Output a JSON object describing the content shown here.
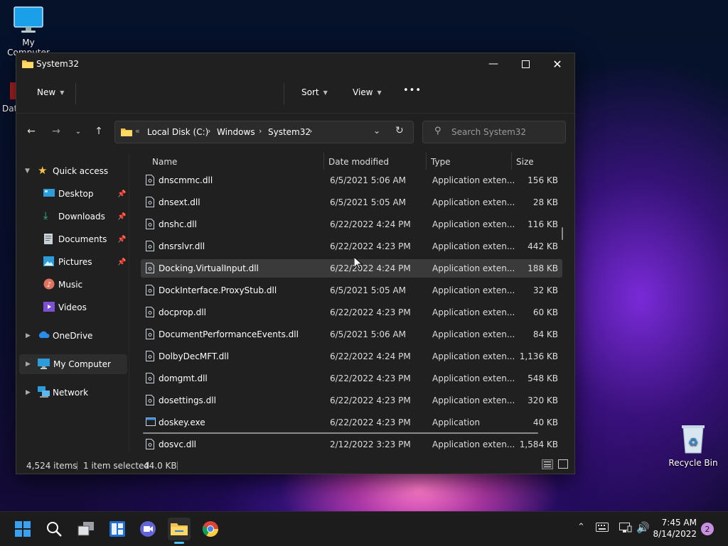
{
  "desktop": {
    "my_computer": "My Computer",
    "partial_label": "Data",
    "recycle_bin": "Recycle Bin"
  },
  "window": {
    "title": "System32",
    "toolbar": {
      "new": "New",
      "sort": "Sort",
      "view": "View",
      "more": "•••"
    },
    "address": {
      "overflow": "«",
      "crumbs": [
        "Local Disk (C:)",
        "Windows",
        "System32"
      ]
    },
    "search_placeholder": "Search System32",
    "sidebar": {
      "quick_access": "Quick access",
      "desktop": "Desktop",
      "downloads": "Downloads",
      "documents": "Documents",
      "pictures": "Pictures",
      "music": "Music",
      "videos": "Videos",
      "onedrive": "OneDrive",
      "my_computer": "My Computer",
      "network": "Network"
    },
    "columns": {
      "name": "Name",
      "date": "Date modified",
      "type": "Type",
      "size": "Size"
    },
    "files": [
      {
        "name": "dnscmmc.dll",
        "date": "6/5/2021 5:06 AM",
        "type": "Application exten...",
        "size": "156 KB"
      },
      {
        "name": "dnsext.dll",
        "date": "6/5/2021 5:05 AM",
        "type": "Application exten...",
        "size": "28 KB"
      },
      {
        "name": "dnshc.dll",
        "date": "6/22/2022 4:24 PM",
        "type": "Application exten...",
        "size": "116 KB"
      },
      {
        "name": "dnsrslvr.dll",
        "date": "6/22/2022 4:23 PM",
        "type": "Application exten...",
        "size": "442 KB"
      },
      {
        "name": "Docking.VirtualInput.dll",
        "date": "6/22/2022 4:24 PM",
        "type": "Application exten...",
        "size": "188 KB"
      },
      {
        "name": "DockInterface.ProxyStub.dll",
        "date": "6/5/2021 5:05 AM",
        "type": "Application exten...",
        "size": "32 KB"
      },
      {
        "name": "docprop.dll",
        "date": "6/22/2022 4:23 PM",
        "type": "Application exten...",
        "size": "60 KB"
      },
      {
        "name": "DocumentPerformanceEvents.dll",
        "date": "6/5/2021 5:06 AM",
        "type": "Application exten...",
        "size": "84 KB"
      },
      {
        "name": "DolbyDecMFT.dll",
        "date": "6/22/2022 4:24 PM",
        "type": "Application exten...",
        "size": "1,136 KB"
      },
      {
        "name": "domgmt.dll",
        "date": "6/22/2022 4:23 PM",
        "type": "Application exten...",
        "size": "548 KB"
      },
      {
        "name": "dosettings.dll",
        "date": "6/22/2022 4:23 PM",
        "type": "Application exten...",
        "size": "320 KB"
      },
      {
        "name": "doskey.exe",
        "date": "6/22/2022 4:23 PM",
        "type": "Application",
        "size": "40 KB"
      },
      {
        "name": "dosvc.dll",
        "date": "2/12/2022 3:23 PM",
        "type": "Application exten...",
        "size": "1,584 KB"
      }
    ],
    "status": {
      "items": "4,524 items",
      "selected": "1 item selected",
      "size": "44.0 KB"
    }
  },
  "taskbar": {
    "time": "7:45 AM",
    "date": "8/14/2022",
    "notifications": "2"
  }
}
